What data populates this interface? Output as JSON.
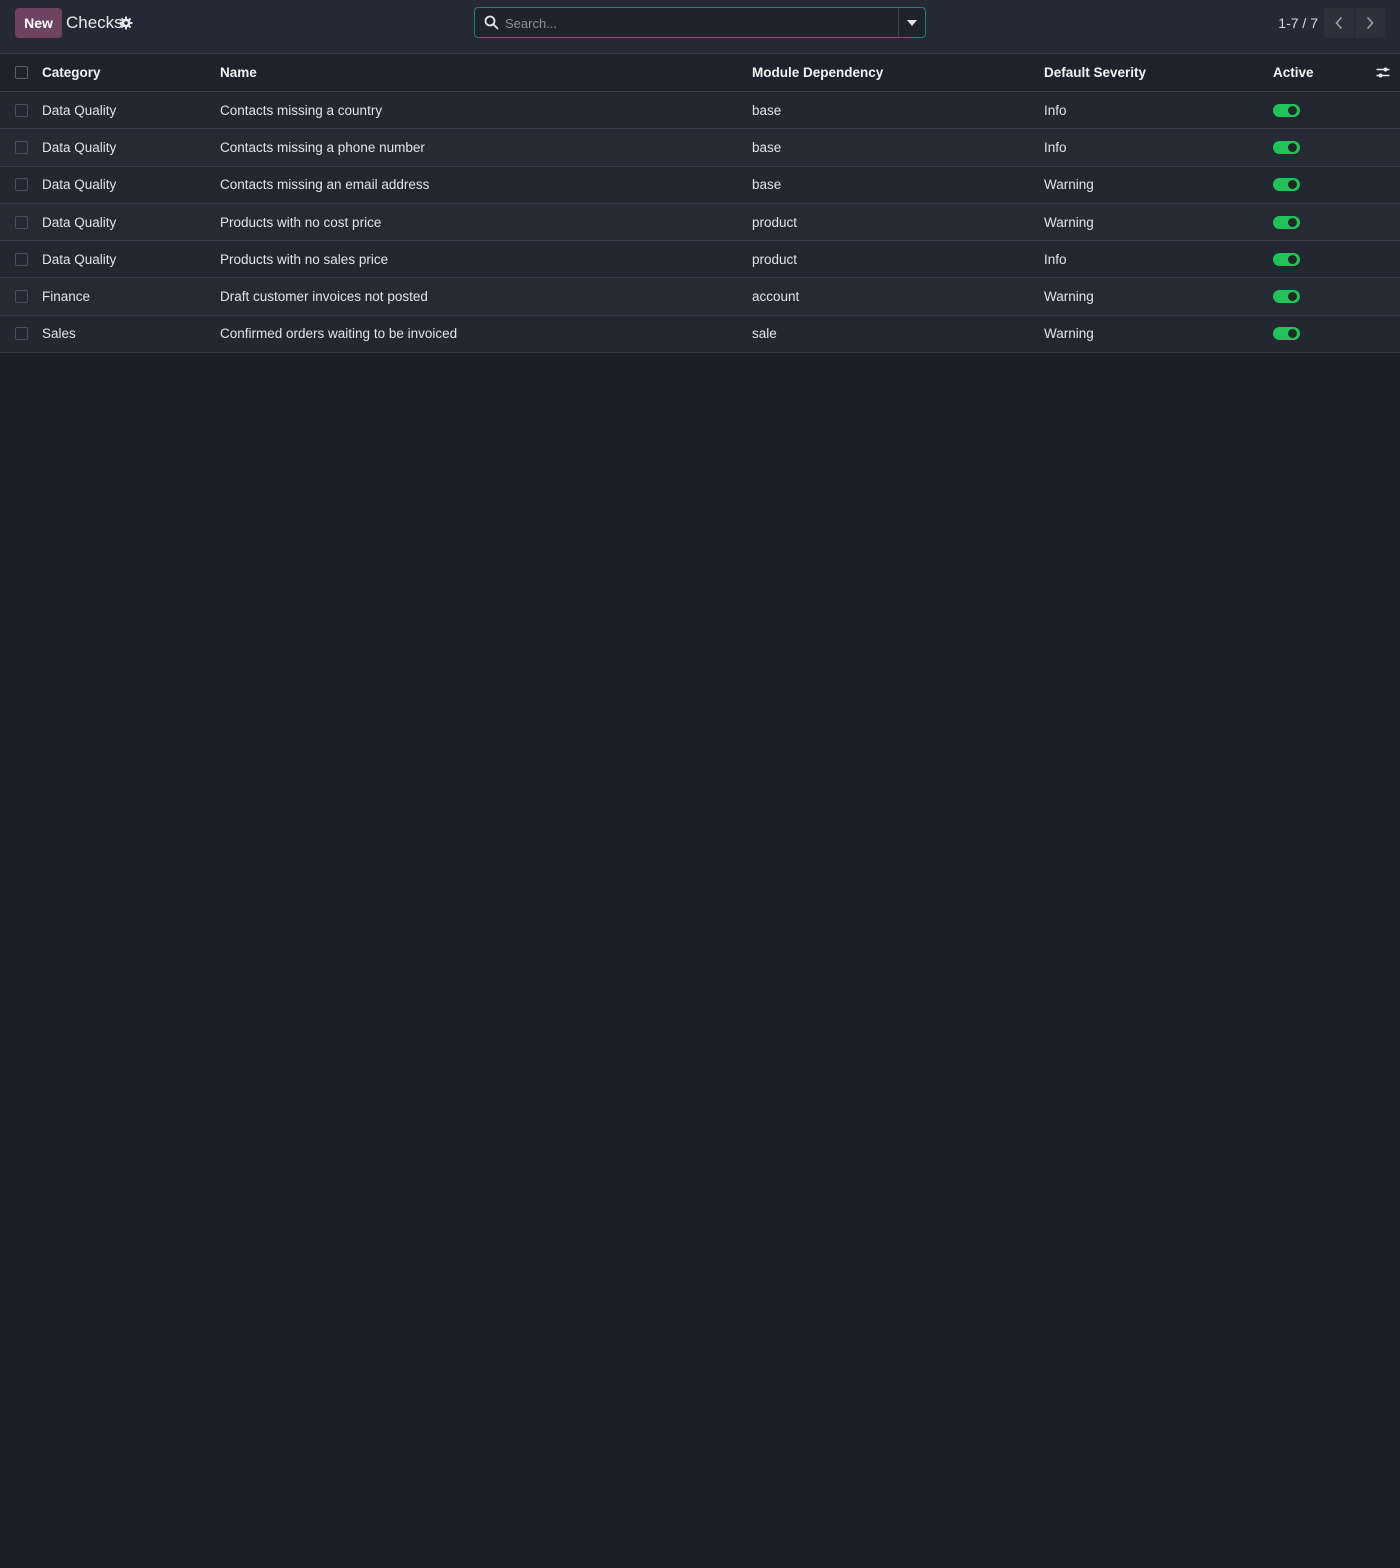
{
  "control_panel": {
    "new_label": "New",
    "title": "Checks",
    "search_placeholder": "Search...",
    "pager_value": "1-7 / 7"
  },
  "columns": {
    "category": "Category",
    "name": "Name",
    "module": "Module Dependency",
    "severity": "Default Severity",
    "active": "Active"
  },
  "rows": [
    {
      "category": "Data Quality",
      "name": "Contacts missing a country",
      "module": "base",
      "severity": "Info",
      "active": true
    },
    {
      "category": "Data Quality",
      "name": "Contacts missing a phone number",
      "module": "base",
      "severity": "Info",
      "active": true
    },
    {
      "category": "Data Quality",
      "name": "Contacts missing an email address",
      "module": "base",
      "severity": "Warning",
      "active": true
    },
    {
      "category": "Data Quality",
      "name": "Products with no cost price",
      "module": "product",
      "severity": "Warning",
      "active": true
    },
    {
      "category": "Data Quality",
      "name": "Products with no sales price",
      "module": "product",
      "severity": "Info",
      "active": true
    },
    {
      "category": "Finance",
      "name": "Draft customer invoices not posted",
      "module": "account",
      "severity": "Warning",
      "active": true
    },
    {
      "category": "Sales",
      "name": "Confirmed orders waiting to be invoiced",
      "module": "sale",
      "severity": "Warning",
      "active": true
    }
  ],
  "colors": {
    "accent_primary": "#6e4362",
    "toggle_on": "#23c15a",
    "search_border": "#2c7a7e",
    "background": "#1b1e26"
  },
  "icons": {
    "title_action": "gear-icon",
    "search": "search-icon",
    "search_toggle": "caret-down-icon",
    "pager_prev": "chevron-left-icon",
    "pager_next": "chevron-right-icon",
    "optional_columns": "sliders-icon"
  }
}
